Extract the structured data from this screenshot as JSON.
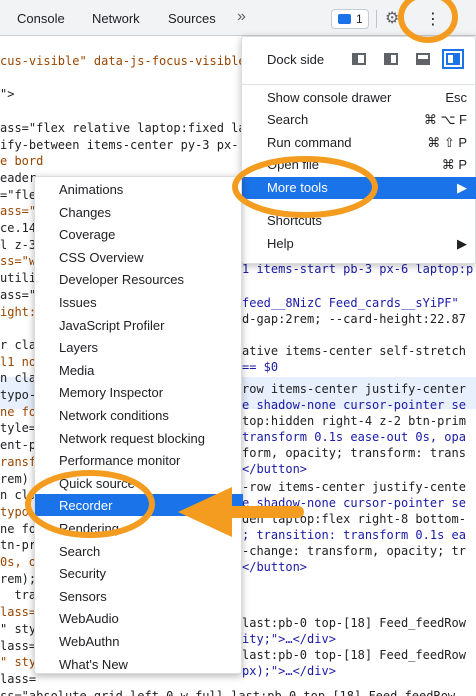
{
  "tabbar": {
    "tabs": [
      "Console",
      "Network",
      "Sources"
    ],
    "more_tabs_glyph": "»",
    "issues_count": "1",
    "gear_glyph": "⚙",
    "kebab_glyph": "⋮"
  },
  "code_lines": [
    "cus-visible\" data-js-focus-visible",
    "",
    "\">",
    "",
    "ass=\"flex relative laptop:fixed lap",
    "ify-between items-center py-3 px-",
    "e bord",
    "eader",
    "=\"fle",
    "ass=\"",
    "ce.14",
    "l z-3",
    "ss=\"w",
    "utili",
    "ass=\"",
    "ight:",
    "",
    "r cla",
    "l1 no",
    "n cla",
    "typo-",
    "ne fo",
    "tyle=\"",
    "ent-p",
    "ransf",
    "rem)",
    "n cla",
    "typo-",
    "ne fo",
    "tn-pr",
    "0s, o",
    "rem);",
    "  tra",
    "lass=",
    "\" sty",
    "lass=",
    "\" sty",
    "lass=",
    "ss=\"absolute grid left-0 w-full last:pb-0 top-[18] Feed_feedRow"
  ],
  "code_right_lines": [
    "r-tertiary transition-[width] tr",
    "top-0  h-full \">…</aside>",
    "1 items-start pb-3 px-6 laptop:p",
    "",
    "feed__8NizC Feed_cards__sYiPF\"",
    "d-gap:2rem; --card-height:22.87",
    "",
    "ative items-center self-stretch",
    "== $0",
    "row items-center justify-center",
    "e shadow-none cursor-pointer se",
    "top:hidden right-4 z-2 btn-prim",
    "transform 0.1s ease-out 0s, opa",
    "form, opacity; transform: trans",
    "</button>",
    "-row items-center justify-cente",
    "e shadow-none cursor-pointer se",
    "den laptop:flex right-8 bottom-",
    "; transition: transform 0.1s ea",
    "-change: transform, opacity; tr",
    "</button>",
    "last:pb-0 top-[18] Feed_feedRow",
    "ity;\">…</div>",
    "last:pb-0 top-[18] Feed_feedRow",
    "px);\">…</div>"
  ],
  "pills": {
    "flex": "flex",
    "grid": "grid"
  },
  "main_menu": {
    "dock_side_label": "Dock side",
    "items": [
      {
        "label": "Show console drawer",
        "shortcut": "Esc"
      },
      {
        "label": "Search",
        "shortcut": "⌘ ⌥ F"
      },
      {
        "label": "Run command",
        "shortcut": "⌘ ⇧ P"
      },
      {
        "label": "Open file",
        "shortcut": "⌘ P"
      },
      {
        "label": "More tools",
        "shortcut": "▶"
      },
      {
        "label": "Shortcuts",
        "shortcut": ""
      },
      {
        "label": "Help",
        "shortcut": "▶"
      }
    ]
  },
  "more_tools_menu": {
    "items": [
      "Animations",
      "Changes",
      "Coverage",
      "CSS Overview",
      "Developer Resources",
      "Issues",
      "JavaScript Profiler",
      "Layers",
      "Media",
      "Memory Inspector",
      "Network conditions",
      "Network request blocking",
      "Performance monitor",
      "Quick source",
      "Recorder",
      "Rendering",
      "Search",
      "Security",
      "Sensors",
      "WebAudio",
      "WebAuthn",
      "What's New"
    ],
    "active_item": "Recorder"
  },
  "colors": {
    "accent": "#1a73e8",
    "annotation": "#f39c1f",
    "code_tag": "#881280",
    "code_attr": "#994500",
    "code_value": "#1a1aa6"
  }
}
